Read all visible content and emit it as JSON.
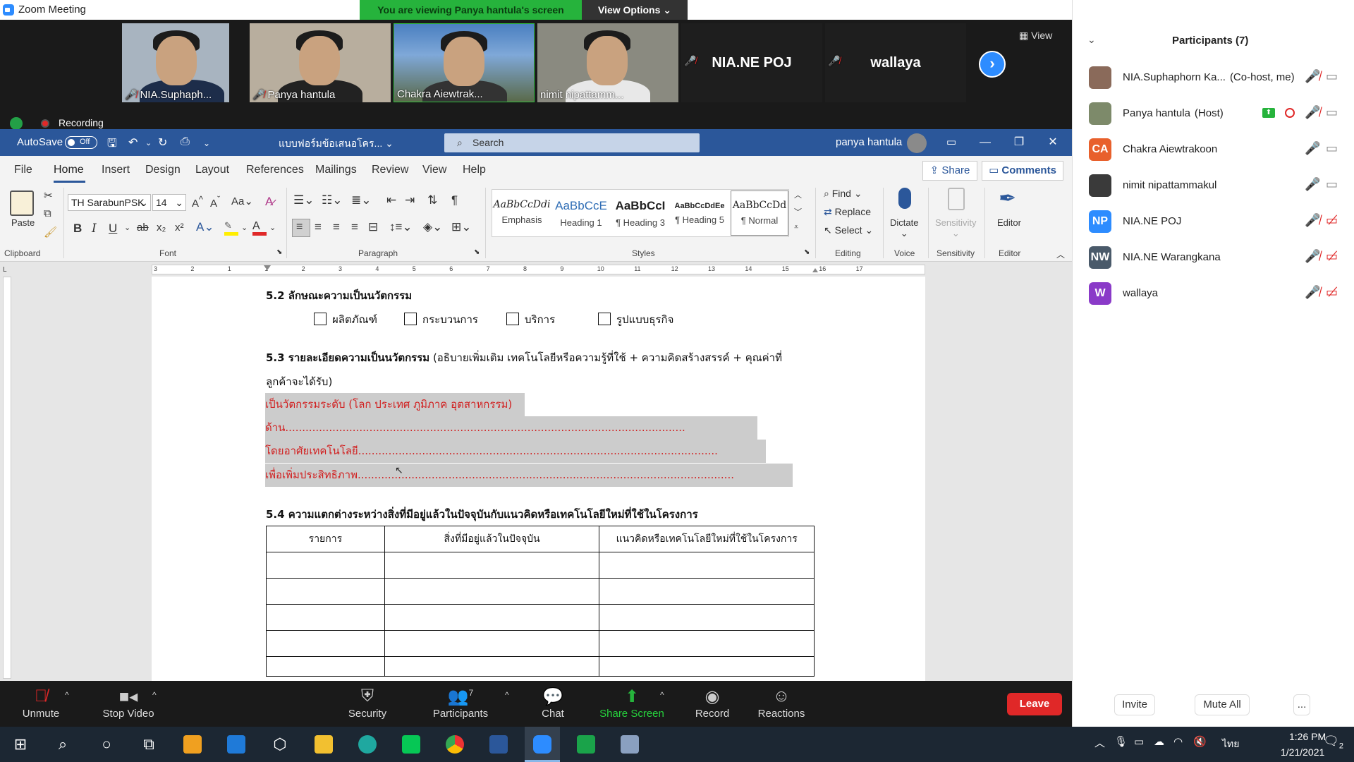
{
  "window": {
    "title": "Zoom Meeting",
    "minimize": "—",
    "restore": "❐",
    "close": "✕"
  },
  "share_banner": {
    "viewing": "You are viewing Panya hantula's screen",
    "view_options": "View Options ⌄"
  },
  "video_tiles": [
    {
      "name": "NIA.Suphaph..."
    },
    {
      "name": "Panya hantula"
    },
    {
      "name": "Chakra Aiewtrak..."
    },
    {
      "name": "nimit nipattamm..."
    },
    {
      "name": "NIA.NE POJ"
    },
    {
      "name": "wallaya"
    }
  ],
  "view_button": "View",
  "recording": "Recording",
  "word": {
    "autosave": "AutoSave",
    "autosave_state": "Off",
    "doc_name": "แบบฟอร์มข้อเสนอโคร...",
    "search_placeholder": "Search",
    "user": "panya hantula",
    "tabs": [
      "File",
      "Home",
      "Insert",
      "Design",
      "Layout",
      "References",
      "Mailings",
      "Review",
      "View",
      "Help"
    ],
    "share": "Share",
    "comments": "Comments",
    "font_name": "TH SarabunPSK",
    "font_size": "14",
    "paste": "Paste",
    "groups": {
      "clipboard": "Clipboard",
      "font": "Font",
      "paragraph": "Paragraph",
      "styles": "Styles",
      "editing": "Editing",
      "voice": "Voice",
      "sensitivity": "Sensitivity",
      "editor": "Editor"
    },
    "styles": [
      {
        "sample": "AaBbCcDdi",
        "name": "Emphasis"
      },
      {
        "sample": "AaBbCcE",
        "name": "Heading 1"
      },
      {
        "sample": "AaBbCcI",
        "name": "¶ Heading 3"
      },
      {
        "sample": "AaBbCcDdEe",
        "name": "¶ Heading 5"
      },
      {
        "sample": "AaBbCcDd",
        "name": "¶ Normal"
      }
    ],
    "find": "Find",
    "replace": "Replace",
    "select": "Select",
    "dictate": "Dictate",
    "sensitivity": "Sensitivity",
    "editor": "Editor"
  },
  "doc": {
    "h52": "5.2 ลักษณะความเป็นนวัตกรรม",
    "checks": [
      "ผลิตภัณฑ์",
      "กระบวนการ",
      "บริการ",
      "รูปแบบธุรกิจ"
    ],
    "h53": "5.3 รายละเอียดความเป็นนวัตกรรม",
    "h53_desc": "(อธิบายเพิ่มเติม เทคโนโลยีหรือความรู้ที่ใช้ + ความคิดสร้างสรรค์ + คุณค่าที่",
    "h53_desc2": "ลูกค้าจะได้รับ)",
    "hl1": "เป็นวัตกรรมระดับ (โลก ประเทศ ภูมิภาค อุตสาหกรรม)",
    "hl2": "ด้าน.......................................................................................................................",
    "hl3": "โดยอาศัยเทคโนโลยี...........................................................................................................",
    "hl4": "เพื่อเพิ่มประสิทธิภาพ................................................................................................................",
    "h54": "5.4 ความแตกต่างระหว่างสิ่งที่มีอยู่แล้วในปัจจุบันกับแนวคิดหรือเทคโนโลยีใหม่ที่ใช้ในโครงการ",
    "table_headers": [
      "รายการ",
      "สิ่งที่มีอยู่แล้วในปัจจุบัน",
      "แนวคิดหรือเทคโนโลยีใหม่ที่ใช้ในโครงการ"
    ]
  },
  "ruler": {
    "labels": [
      "3",
      "2",
      "1",
      "1",
      "2",
      "3",
      "4",
      "5",
      "6",
      "7",
      "8",
      "9",
      "10",
      "11",
      "12",
      "13",
      "14",
      "15",
      "16",
      "17"
    ]
  },
  "controls": {
    "unmute": "Unmute",
    "stop_video": "Stop Video",
    "security": "Security",
    "participants": "Participants",
    "participants_count": "7",
    "chat": "Chat",
    "share_screen": "Share Screen",
    "record": "Record",
    "reactions": "Reactions",
    "leave": "Leave"
  },
  "panel": {
    "title": "Participants (7)",
    "participants": [
      {
        "name": "NIA.Suphaphorn Ka...",
        "role": "(Co-host, me)",
        "initials": "",
        "color": "#8a6a5a"
      },
      {
        "name": "Panya hantula",
        "role": "(Host)",
        "initials": "",
        "color": "#7d8a6a"
      },
      {
        "name": "Chakra Aiewtrakoon",
        "role": "",
        "initials": "CA",
        "color": "#e8602c"
      },
      {
        "name": "nimit nipattammakul",
        "role": "",
        "initials": "",
        "color": "#3a3a3a"
      },
      {
        "name": "NIA.NE POJ",
        "role": "",
        "initials": "NP",
        "color": "#2d8cff"
      },
      {
        "name": "NIA.NE Warangkana",
        "role": "",
        "initials": "NW",
        "color": "#4a5a6a"
      },
      {
        "name": "wallaya",
        "role": "",
        "initials": "W",
        "color": "#8a3ac8"
      }
    ],
    "invite": "Invite",
    "mute_all": "Mute All",
    "more": "..."
  },
  "taskbar": {
    "lang": "ไทย",
    "time": "1:26 PM",
    "date": "1/21/2021",
    "notification_count": "2"
  }
}
